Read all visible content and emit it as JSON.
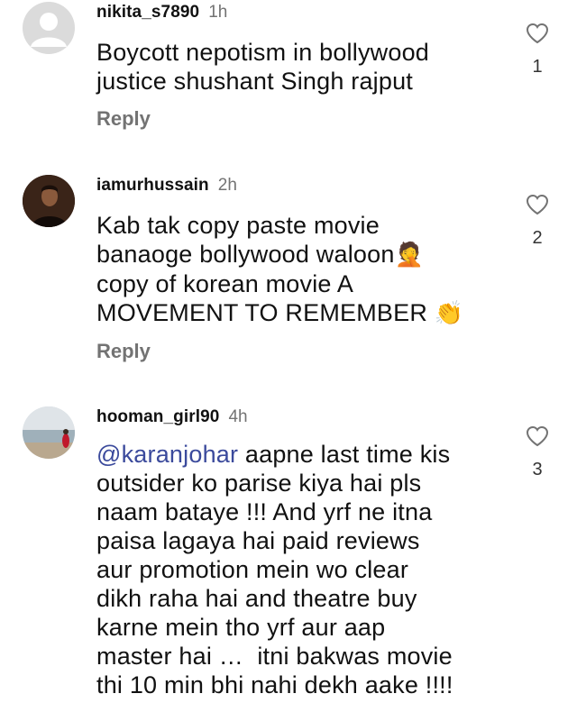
{
  "comments": [
    {
      "username": "nikita_s7890",
      "time": "1h",
      "lines": [
        "Boycott nepotism in bollywood",
        "justice shushant Singh rajput"
      ],
      "reply_label": "Reply",
      "like_count": "1",
      "avatar": "default-avatar"
    },
    {
      "username": "iamurhussain",
      "time": "2h",
      "lines": [
        "Kab tak copy paste movie",
        "banaoge bollywood waloon",
        "copy of korean movie A",
        "MOVEMENT TO REMEMBER"
      ],
      "emojis": [
        "🤦",
        "👏"
      ],
      "reply_label": "Reply",
      "like_count": "2",
      "avatar": "photo-avatar"
    },
    {
      "username": "hooman_girl90",
      "time": "4h",
      "mention": "@karanjohar",
      "lines": [
        " aapne last time kis",
        "outsider ko parise kiya hai pls",
        "naam bataye !!! And yrf ne itna",
        "paisa lagaya hai paid reviews",
        "aur promotion mein wo clear",
        "dikh raha hai and theatre buy",
        "karne mein tho yrf aur aap",
        "master hai …  itni bakwas movie",
        "thi 10 min bhi nahi dekh aake !!!!"
      ],
      "like_count": "3",
      "avatar": "beach-photo-avatar"
    }
  ]
}
